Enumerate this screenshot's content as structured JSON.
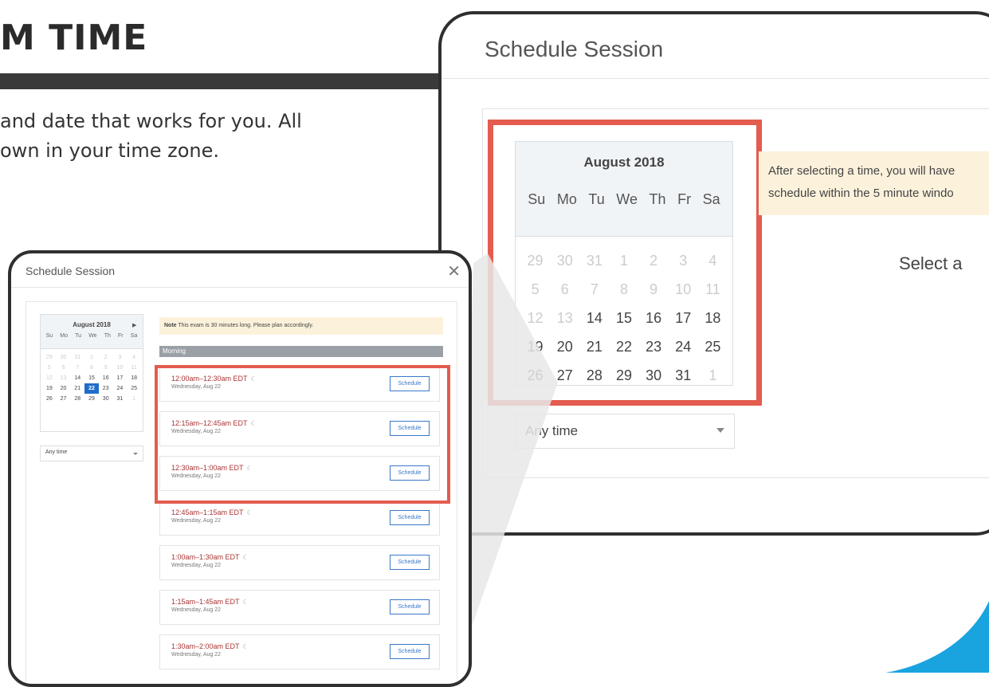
{
  "page": {
    "title": "M TIME",
    "intro_lines": [
      "and date that works for you. All",
      "own in your time zone."
    ]
  },
  "colors": {
    "highlight": "#e35c4f",
    "title_bar": "#3a3a3a",
    "accent_blue": "#1f6dc9",
    "note_bg": "#fcf2dc",
    "swoosh": "#19a4df"
  },
  "zoom": {
    "title": "Schedule Session",
    "calendar": {
      "month": "August 2018",
      "dow": [
        "Su",
        "Mo",
        "Tu",
        "We",
        "Th",
        "Fr",
        "Sa"
      ],
      "days": [
        {
          "d": "29",
          "muted": true
        },
        {
          "d": "30",
          "muted": true
        },
        {
          "d": "31",
          "muted": true
        },
        {
          "d": "1",
          "muted": true
        },
        {
          "d": "2",
          "muted": true
        },
        {
          "d": "3",
          "muted": true
        },
        {
          "d": "4",
          "muted": true
        },
        {
          "d": "5",
          "muted": true
        },
        {
          "d": "6",
          "muted": true
        },
        {
          "d": "7",
          "muted": true
        },
        {
          "d": "8",
          "muted": true
        },
        {
          "d": "9",
          "muted": true
        },
        {
          "d": "10",
          "muted": true
        },
        {
          "d": "11",
          "muted": true
        },
        {
          "d": "12",
          "muted": true
        },
        {
          "d": "13",
          "muted": true
        },
        {
          "d": "14"
        },
        {
          "d": "15"
        },
        {
          "d": "16"
        },
        {
          "d": "17"
        },
        {
          "d": "18"
        },
        {
          "d": "19"
        },
        {
          "d": "20"
        },
        {
          "d": "21"
        },
        {
          "d": "22"
        },
        {
          "d": "23"
        },
        {
          "d": "24"
        },
        {
          "d": "25"
        },
        {
          "d": "26"
        },
        {
          "d": "27"
        },
        {
          "d": "28"
        },
        {
          "d": "29"
        },
        {
          "d": "30"
        },
        {
          "d": "31"
        },
        {
          "d": "1",
          "muted": true
        }
      ]
    },
    "note_lines": [
      "After selecting a time, you will have",
      "schedule within the 5 minute windo"
    ],
    "select_prompt": "Select a",
    "time_filter": "Any time"
  },
  "modal": {
    "title": "Schedule Session",
    "close": "✕",
    "calendar": {
      "month": "August 2018",
      "next": "▶",
      "dow": [
        "Su",
        "Mo",
        "Tu",
        "We",
        "Th",
        "Fr",
        "Sa"
      ],
      "selected": "22",
      "days": [
        {
          "d": "29",
          "muted": true
        },
        {
          "d": "30",
          "muted": true
        },
        {
          "d": "31",
          "muted": true
        },
        {
          "d": "1",
          "muted": true
        },
        {
          "d": "2",
          "muted": true
        },
        {
          "d": "3",
          "muted": true
        },
        {
          "d": "4",
          "muted": true
        },
        {
          "d": "5",
          "muted": true
        },
        {
          "d": "6",
          "muted": true
        },
        {
          "d": "7",
          "muted": true
        },
        {
          "d": "8",
          "muted": true
        },
        {
          "d": "9",
          "muted": true
        },
        {
          "d": "10",
          "muted": true
        },
        {
          "d": "11",
          "muted": true
        },
        {
          "d": "12",
          "muted": true
        },
        {
          "d": "13",
          "muted": true
        },
        {
          "d": "14"
        },
        {
          "d": "15"
        },
        {
          "d": "16"
        },
        {
          "d": "17"
        },
        {
          "d": "18"
        },
        {
          "d": "19"
        },
        {
          "d": "20"
        },
        {
          "d": "21"
        },
        {
          "d": "22"
        },
        {
          "d": "23"
        },
        {
          "d": "24"
        },
        {
          "d": "25"
        },
        {
          "d": "26"
        },
        {
          "d": "27"
        },
        {
          "d": "28"
        },
        {
          "d": "29"
        },
        {
          "d": "30"
        },
        {
          "d": "31"
        },
        {
          "d": "1",
          "muted": true
        }
      ]
    },
    "time_filter": "Any time",
    "note_bold": "Note",
    "note_text": " This exam is 30 minutes long. Please plan accordingly.",
    "section": "Morning",
    "schedule_label": "Schedule",
    "moon_icon": "☾",
    "slots": [
      {
        "time": "12:00am–12:30am EDT",
        "date": "Wednesday, Aug 22"
      },
      {
        "time": "12:15am–12:45am EDT",
        "date": "Wednesday, Aug 22"
      },
      {
        "time": "12:30am–1:00am EDT",
        "date": "Wednesday, Aug 22"
      },
      {
        "time": "12:45am–1:15am EDT",
        "date": "Wednesday, Aug 22"
      },
      {
        "time": "1:00am–1:30am EDT",
        "date": "Wednesday, Aug 22"
      },
      {
        "time": "1:15am–1:45am EDT",
        "date": "Wednesday, Aug 22"
      },
      {
        "time": "1:30am–2:00am EDT",
        "date": "Wednesday, Aug 22"
      }
    ]
  }
}
